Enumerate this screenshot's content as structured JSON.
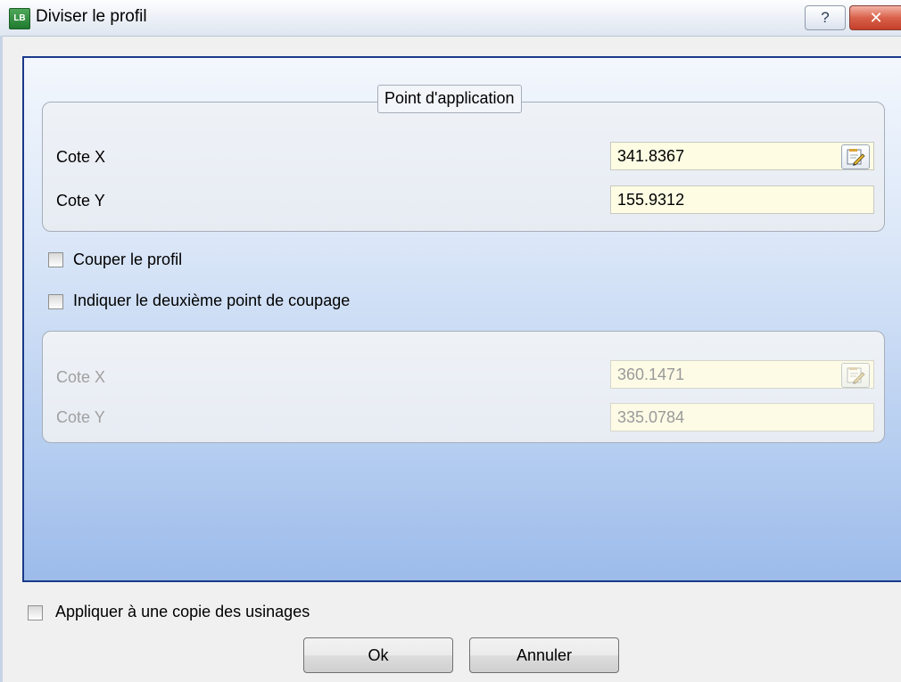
{
  "window": {
    "title": "Diviser le profil",
    "app_icon": "app-icon",
    "help_label": "?",
    "close_label": "✕"
  },
  "group1": {
    "legend": "Point d'application",
    "x_label": "Cote X",
    "x_value": "341.8367",
    "y_label": "Cote Y",
    "y_value": "155.9312"
  },
  "options": {
    "cut_profile_label": "Couper le profil",
    "cut_profile_checked": false,
    "second_point_label": "Indiquer le deuxième point de coupage",
    "second_point_checked": false
  },
  "group2": {
    "x_label": "Cote X",
    "x_value": "360.1471",
    "y_label": "Cote Y",
    "y_value": "335.0784",
    "disabled": true
  },
  "footer": {
    "apply_copy_label": "Appliquer à une copie des usinages",
    "apply_copy_checked": false,
    "ok_label": "Ok",
    "cancel_label": "Annuler"
  }
}
